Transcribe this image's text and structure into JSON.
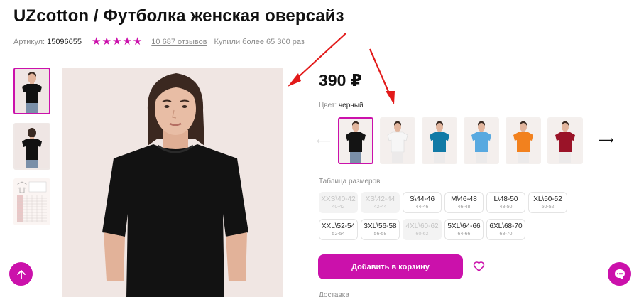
{
  "product": {
    "title": "UZcotton / Футболка женская оверсайз",
    "article_label": "Артикул:",
    "article_value": "15096655",
    "rating_stars": 5,
    "reviews": "10 687 отзывов",
    "purchases": "Купили более 65 300 раз",
    "price": "390 ₽",
    "color_label": "Цвет:",
    "color_value": "черный",
    "size_table_link": "Таблица размеров",
    "add_to_cart": "Добавить в корзину",
    "delivery_label": "Доставка"
  },
  "swatches": [
    {
      "color": "#141414",
      "selected": true
    },
    {
      "color": "#f6f6f6",
      "selected": false
    },
    {
      "color": "#117aa6",
      "selected": false
    },
    {
      "color": "#58a9e0",
      "selected": false
    },
    {
      "color": "#f2811e",
      "selected": false
    },
    {
      "color": "#9a1328",
      "selected": false
    }
  ],
  "sizes": [
    {
      "label": "XXS\\40-42",
      "sub": "40-42",
      "available": false
    },
    {
      "label": "XS\\42-44",
      "sub": "42-44",
      "available": false
    },
    {
      "label": "S\\44-46",
      "sub": "44-46",
      "available": true
    },
    {
      "label": "M\\46-48",
      "sub": "46-48",
      "available": true
    },
    {
      "label": "L\\48-50",
      "sub": "48-50",
      "available": true
    },
    {
      "label": "XL\\50-52",
      "sub": "50-52",
      "available": true
    },
    {
      "label": "XXL\\52-54",
      "sub": "52-54",
      "available": true
    },
    {
      "label": "3XL\\56-58",
      "sub": "56-58",
      "available": true
    },
    {
      "label": "4XL\\60-62",
      "sub": "60-62",
      "available": false
    },
    {
      "label": "5XL\\64-66",
      "sub": "64-66",
      "available": true
    },
    {
      "label": "6XL\\68-70",
      "sub": "68-70",
      "available": true
    }
  ],
  "icons": {
    "star": "star-icon",
    "heart": "heart-icon",
    "scroll_up": "arrow-up-icon",
    "chat": "chat-icon",
    "next": "arrow-right-icon",
    "prev": "arrow-left-icon"
  },
  "colors": {
    "accent": "#cb11ab",
    "annotation": "#e21a1a"
  }
}
